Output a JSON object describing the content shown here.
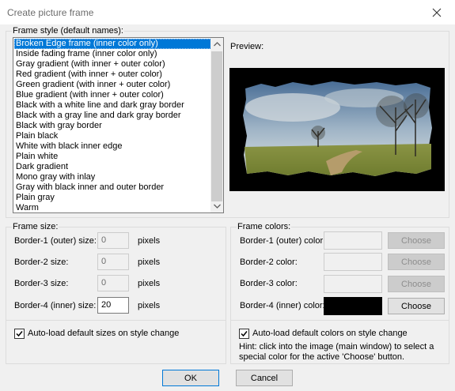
{
  "window": {
    "title": "Create picture frame"
  },
  "frame_style": {
    "legend": "Frame style (default names):",
    "selected_index": 0,
    "items": [
      "Broken Edge frame (inner color only)",
      "Inside fading frame (inner color only)",
      "Gray gradient (with inner + outer color)",
      "Red gradient (with inner + outer color)",
      "Green gradient (with inner + outer color)",
      "Blue gradient (with inner + outer color)",
      "Black with a white line and dark gray border",
      "Black with a gray line and dark gray border",
      "Black with gray border",
      "Plain black",
      "White with black inner edge",
      "Plain white",
      "Dark gradient",
      "Mono gray with inlay",
      "Gray with black inner and outer border",
      "Plain gray",
      "Warm"
    ]
  },
  "preview": {
    "label": "Preview:"
  },
  "frame_size": {
    "legend": "Frame size:",
    "rows": [
      {
        "label": "Border-1 (outer) size:",
        "value": "0",
        "unit": "pixels"
      },
      {
        "label": "Border-2 size:",
        "value": "0",
        "unit": "pixels"
      },
      {
        "label": "Border-3 size:",
        "value": "0",
        "unit": "pixels"
      },
      {
        "label": "Border-4 (inner) size:",
        "value": "20",
        "unit": "pixels"
      }
    ],
    "autoload_label": "Auto-load default sizes on style change",
    "autoload_checked": true
  },
  "frame_colors": {
    "legend": "Frame colors:",
    "rows": [
      {
        "label": "Border-1 (outer) color:",
        "button": "Choose",
        "color": "#f0f0f0"
      },
      {
        "label": "Border-2 color:",
        "button": "Choose",
        "color": "#f0f0f0"
      },
      {
        "label": "Border-3 color:",
        "button": "Choose",
        "color": "#f0f0f0"
      },
      {
        "label": "Border-4 (inner) color:",
        "button": "Choose",
        "color": "#000000"
      }
    ],
    "autoload_label": "Auto-load default colors on style change",
    "autoload_checked": true,
    "hint_line1": "Hint: click into the image (main window) to select a",
    "hint_line2": "special color for the active 'Choose' button."
  },
  "buttons": {
    "ok": "OK",
    "cancel": "Cancel"
  }
}
